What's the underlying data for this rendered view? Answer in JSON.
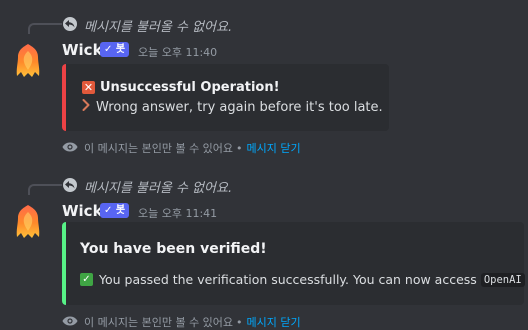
{
  "messages": [
    {
      "reply_text": "메시지를 불러올 수 없어요.",
      "username": "Wick",
      "bot_tag": "✓ 봇",
      "timestamp": "오늘 오후 11:40",
      "embed": {
        "color": "#ed4245",
        "title": "Unsuccessful Operation!",
        "description": "Wrong answer, try again before it's too late."
      },
      "footer": {
        "notice": "이 메시지는 본인만 볼 수 있어요",
        "separator": "•",
        "dismiss": "메시지 닫기"
      }
    },
    {
      "reply_text": "메시지를 불러올 수 없어요.",
      "username": "Wick",
      "bot_tag": "✓ 봇",
      "timestamp": "오늘 오후 11:41",
      "embed": {
        "color": "#57f287",
        "title": "You have been verified!",
        "description_before": "You passed the verification successfully. You can now access",
        "code": "OpenAI",
        "description_after": "!"
      },
      "footer": {
        "notice": "이 메시지는 본인만 볼 수 있어요",
        "separator": "•",
        "dismiss": "메시지 닫기"
      }
    }
  ],
  "icons": {
    "reply": "reply-arrow-icon",
    "avatar": "flame-avatar",
    "error": "x-mark-emoji-icon",
    "success": "check-mark-emoji-icon",
    "chevron": "chevron-right-icon",
    "eye": "eye-icon"
  },
  "colors": {
    "background": "#313338",
    "embed_background": "#2b2d31",
    "bot_tag": "#5865f2",
    "link": "#00a8fc"
  }
}
